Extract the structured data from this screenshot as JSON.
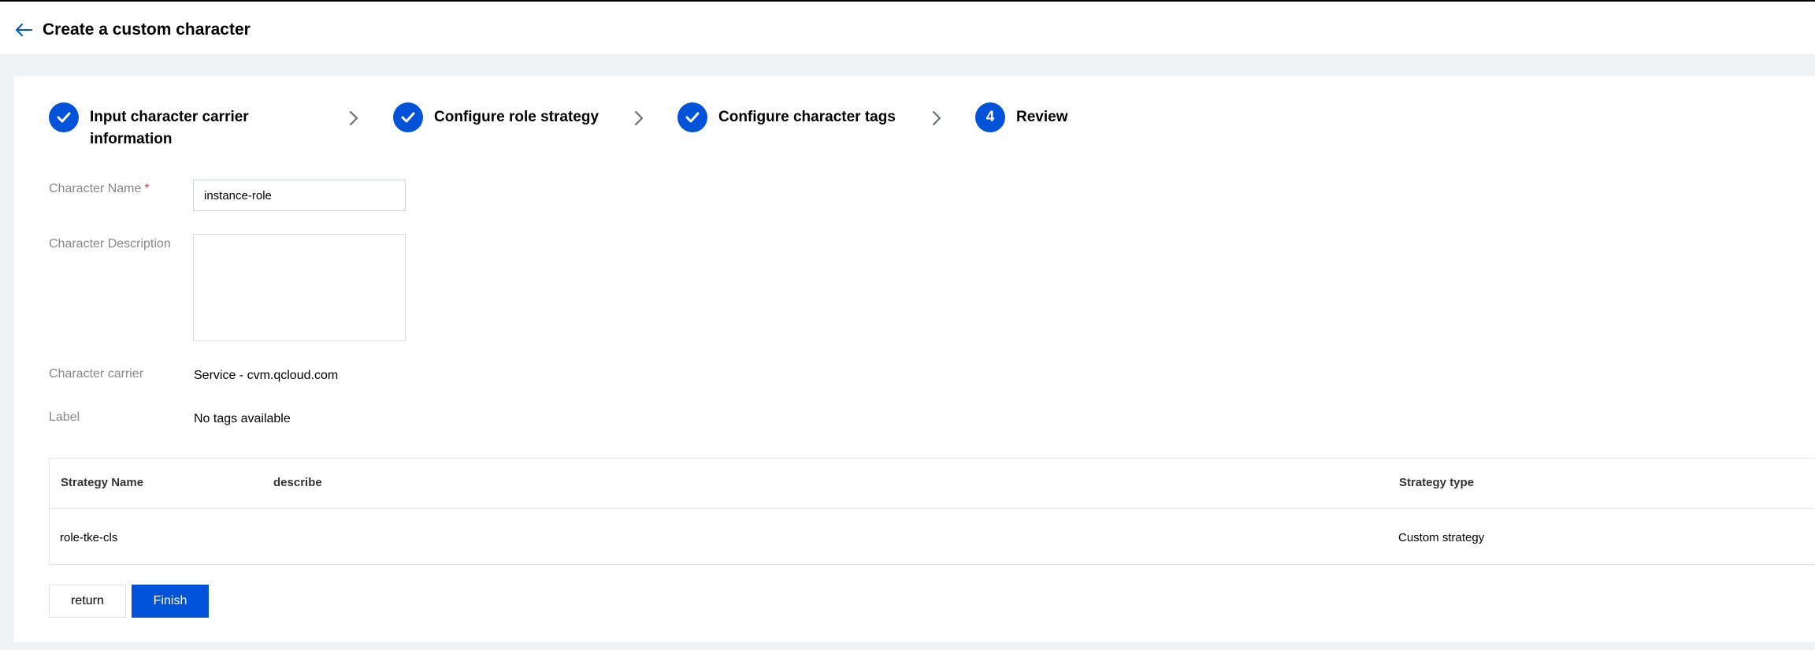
{
  "header": {
    "title": "Create a custom character"
  },
  "steps": [
    {
      "label_line1": "Input character carrier",
      "label_line2": "information",
      "status": "done"
    },
    {
      "label": "Configure role strategy",
      "status": "done"
    },
    {
      "label": "Configure character tags",
      "status": "done"
    },
    {
      "number": "4",
      "label": "Review",
      "status": "current"
    }
  ],
  "form": {
    "name_label": "Character Name",
    "required_mark": "*",
    "name_value": "instance-role",
    "description_label": "Character Description",
    "description_value": "",
    "carrier_label": "Character carrier",
    "carrier_value": "Service - cvm.qcloud.com",
    "tag_label": "Label",
    "tag_value": "No tags available"
  },
  "table": {
    "columns": [
      "Strategy Name",
      "describe",
      "Strategy type"
    ],
    "rows": [
      {
        "name": "role-tke-cls",
        "describe": "",
        "type": "Custom strategy"
      }
    ]
  },
  "buttons": {
    "return_label": "return",
    "finish_label": "Finish"
  },
  "colors": {
    "primary": "#0052d9",
    "required": "#e54545",
    "background": "#f2f3f5"
  },
  "icons": {
    "back": "arrow-left-icon",
    "step_done": "check-icon",
    "step_separator": "chevron-right-icon"
  }
}
